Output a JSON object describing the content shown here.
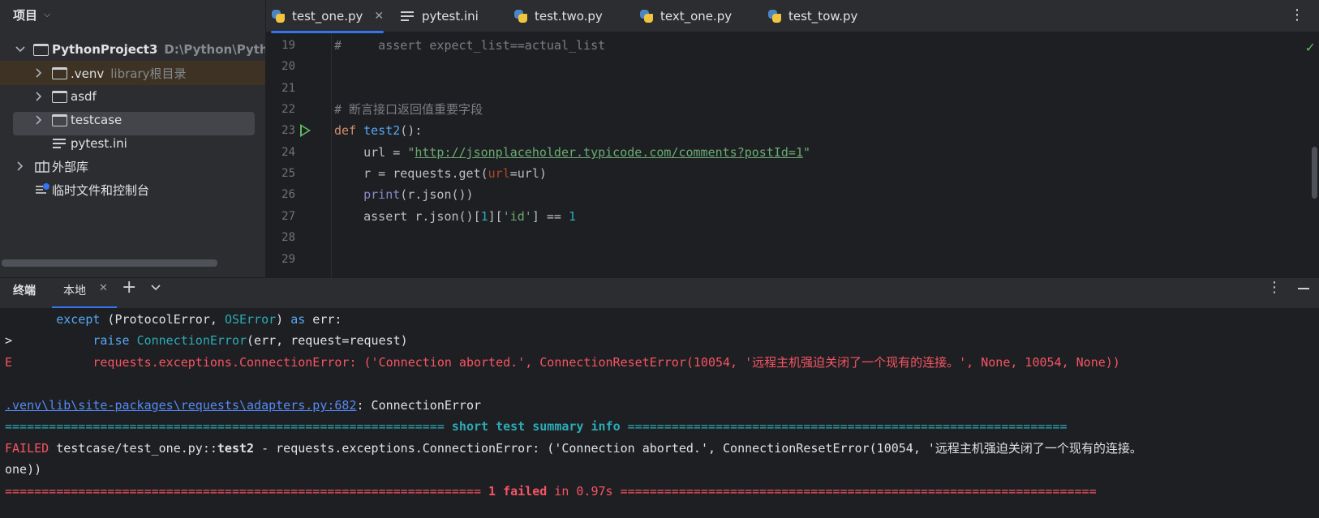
{
  "project": {
    "header_label": "项目",
    "root": {
      "name": "PythonProject3",
      "path": "D:\\Python\\PythonP"
    },
    "venv": {
      "name": ".venv",
      "hint": "library根目录"
    },
    "folder_asdf": "asdf",
    "folder_testcase": "testcase",
    "file_pytest_ini": "pytest.ini",
    "external_libs": "外部库",
    "scratches": "临时文件和控制台"
  },
  "tabs": [
    {
      "label": "test_one.py",
      "active": true
    },
    {
      "label": "pytest.ini"
    },
    {
      "label": "test.two.py"
    },
    {
      "label": "text_one.py"
    },
    {
      "label": "test_tow.py"
    }
  ],
  "editor": {
    "line_numbers": [
      "19",
      "20",
      "21",
      "22",
      "23",
      "24",
      "25",
      "26",
      "27",
      "28",
      "29"
    ],
    "line19": {
      "hash": "#",
      "text": "     assert expect_list==actual_list"
    },
    "line22": "# 断言接口返回值重要字段",
    "line23": {
      "kw": "def",
      "fn": "test2",
      "rest": "():"
    },
    "line24": {
      "pre": "    url = ",
      "q1": "\"",
      "url": "http://jsonplaceholder.typicode.com/comments?postId=1",
      "q2": "\""
    },
    "line25": {
      "pre": "    r = requests.get(",
      "param": "url",
      "post": "=url)"
    },
    "line26": {
      "pre": "    ",
      "bi": "print",
      "post": "(r.json())"
    },
    "line27": {
      "pre": "    assert r.json()[",
      "n1": "1",
      "mid": "][",
      "s": "'id'",
      "mid2": "] == ",
      "n2": "1"
    }
  },
  "terminal": {
    "title": "终端",
    "tab_label": "本地",
    "lines": {
      "l1": {
        "indent": "       ",
        "kw": "except",
        "a": " (ProtocolError, ",
        "cls": "OSError",
        "b": ") ",
        "kw2": "as",
        "c": " err:"
      },
      "l2": {
        "prefix": ">           ",
        "kw": "raise",
        "sp": " ",
        "cls": "ConnectionError",
        "rest": "(err, request=request)"
      },
      "l3": {
        "prefix": "E           ",
        "text": "requests.exceptions.ConnectionError: ('Connection aborted.', ConnectionResetError(10054, '远程主机强迫关闭了一个现有的连接。', None, 10054, None))"
      },
      "l5": {
        "link": ".venv\\lib\\site-packages\\requests\\adapters.py:682",
        "rest": ": ConnectionError"
      },
      "l6": {
        "left": "============================================================",
        "mid": " short test summary info ",
        "right": "============================================================"
      },
      "l7": {
        "failed": "FAILED",
        "a": " testcase/test_one.py::",
        "test": "test2",
        "b": " - requests.exceptions.ConnectionError: ('Connection aborted.', ConnectionResetError(10054, '远程主机强迫关闭了一个现有的连接。"
      },
      "l8": "one))",
      "l9": {
        "left": "=================================================================",
        "mid1": " 1 failed",
        "mid2": " in 0.97s ",
        "right": "================================================================="
      }
    }
  }
}
